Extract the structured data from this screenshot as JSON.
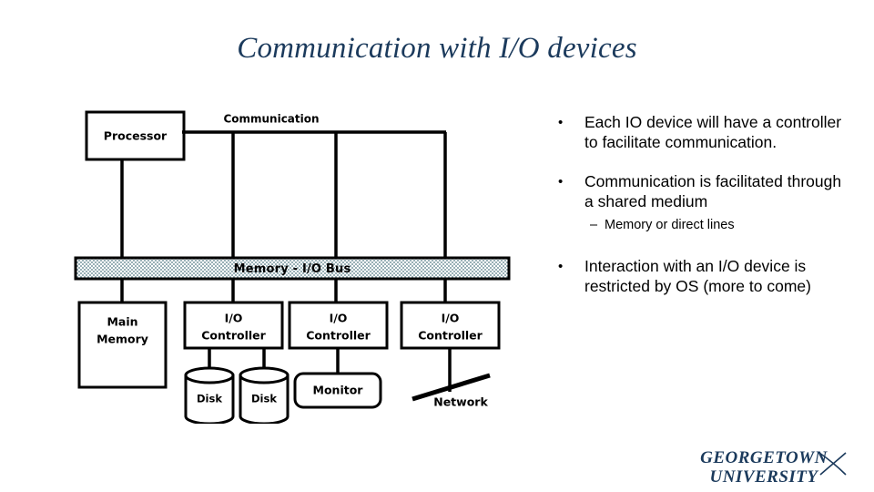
{
  "slide": {
    "title": "Communication with I/O devices",
    "title_color": "#1b3a5c",
    "background": "#ffffff"
  },
  "diagram": {
    "communication_label": "Communication",
    "processor_label": "Processor",
    "bus_label": "Memory - I/O Bus",
    "bus_fill": "#d9e5e8",
    "main_memory_line1": "Main",
    "main_memory_line2": "Memory",
    "controllers": [
      {
        "line1": "I/O",
        "line2": "Controller"
      },
      {
        "line1": "I/O",
        "line2": "Controller"
      },
      {
        "line1": "I/O",
        "line2": "Controller"
      }
    ],
    "devices": {
      "disk1": "Disk",
      "disk2": "Disk",
      "monitor": "Monitor",
      "network": "Network"
    }
  },
  "bullets": [
    {
      "level": 1,
      "mark": "•",
      "text": "Each IO device will have a controller to facilitate communication."
    },
    {
      "level": 1,
      "mark": "•",
      "text": "Communication is facilitated through a shared medium"
    },
    {
      "level": 2,
      "mark": "–",
      "text": "Memory or direct lines"
    },
    {
      "level": 1,
      "mark": "•",
      "text": "Interaction with an I/O device is restricted by OS (more to come)"
    }
  ],
  "logo": {
    "line1": "GEORGETOWN",
    "line2": "UNIVERSITY",
    "color": "#1b3a5c"
  }
}
